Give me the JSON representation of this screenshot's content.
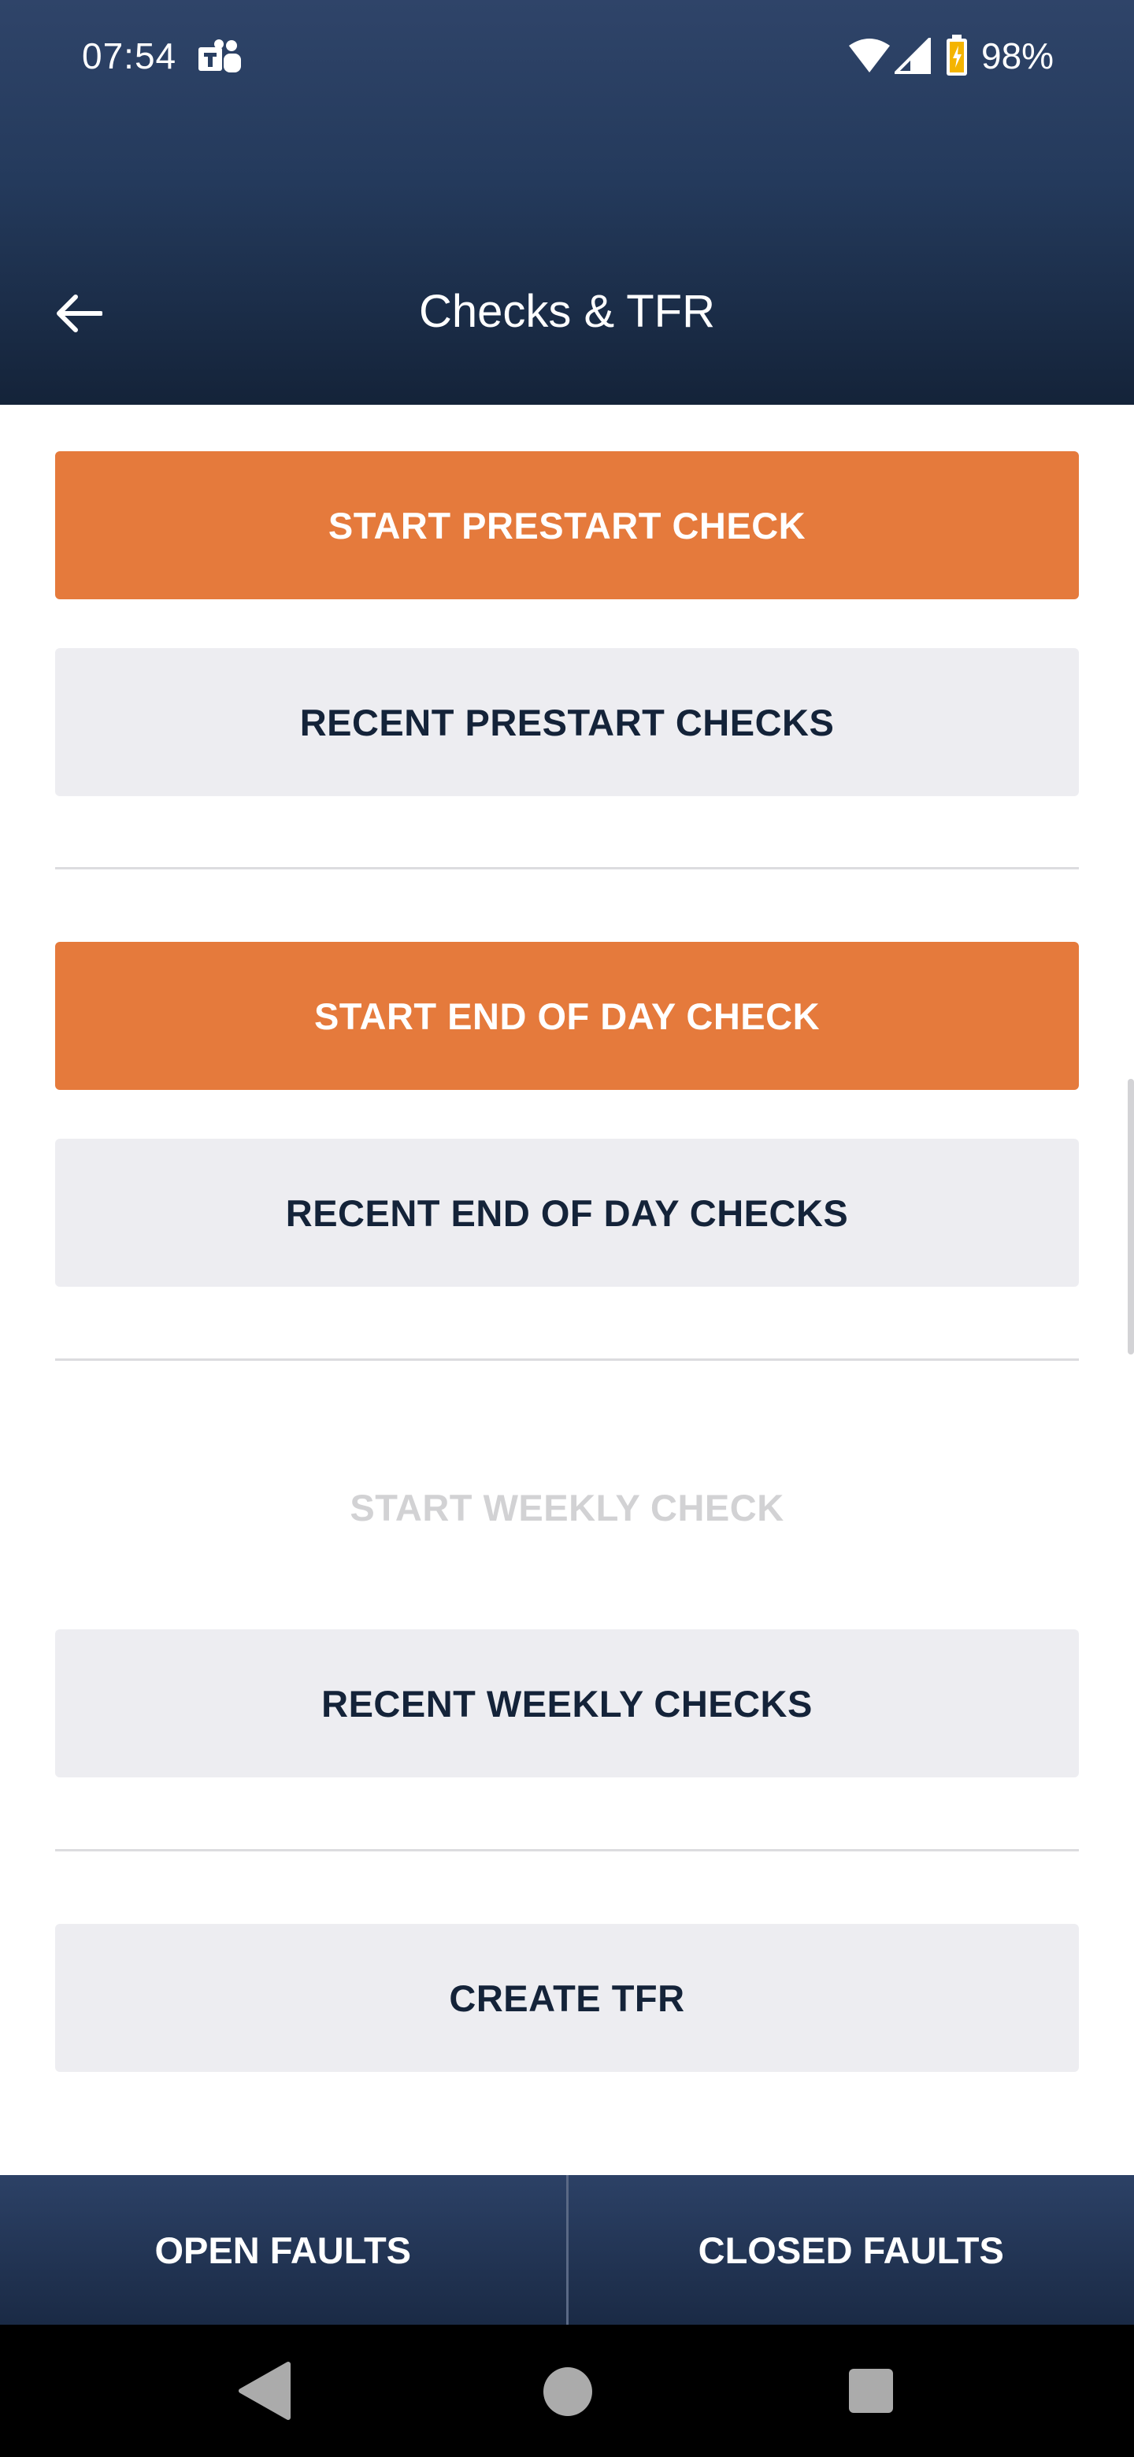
{
  "status_bar": {
    "time": "07:54",
    "battery": "98%",
    "icons": [
      "teams-icon",
      "wifi-icon",
      "signal-icon",
      "battery-icon"
    ]
  },
  "header": {
    "title": "Checks & TFR",
    "back_icon": "arrow-left-icon"
  },
  "sections": {
    "prestart": {
      "start_label": "START PRESTART CHECK",
      "recent_label": "RECENT PRESTART CHECKS"
    },
    "end_of_day": {
      "start_label": "START END OF DAY CHECK",
      "recent_label": "RECENT END OF DAY CHECKS"
    },
    "weekly": {
      "start_label": "START WEEKLY CHECK",
      "recent_label": "RECENT WEEKLY CHECKS"
    },
    "tfr": {
      "create_label": "CREATE TFR"
    }
  },
  "bottom_tabs": {
    "open_faults": "OPEN FAULTS",
    "closed_faults": "CLOSED FAULTS"
  },
  "colors": {
    "accent_orange": "#e57a3c",
    "header_navy": "#243a5c",
    "button_grey": "#ededf1",
    "text_dark": "#142339",
    "disabled_text": "#d2d2d4"
  }
}
